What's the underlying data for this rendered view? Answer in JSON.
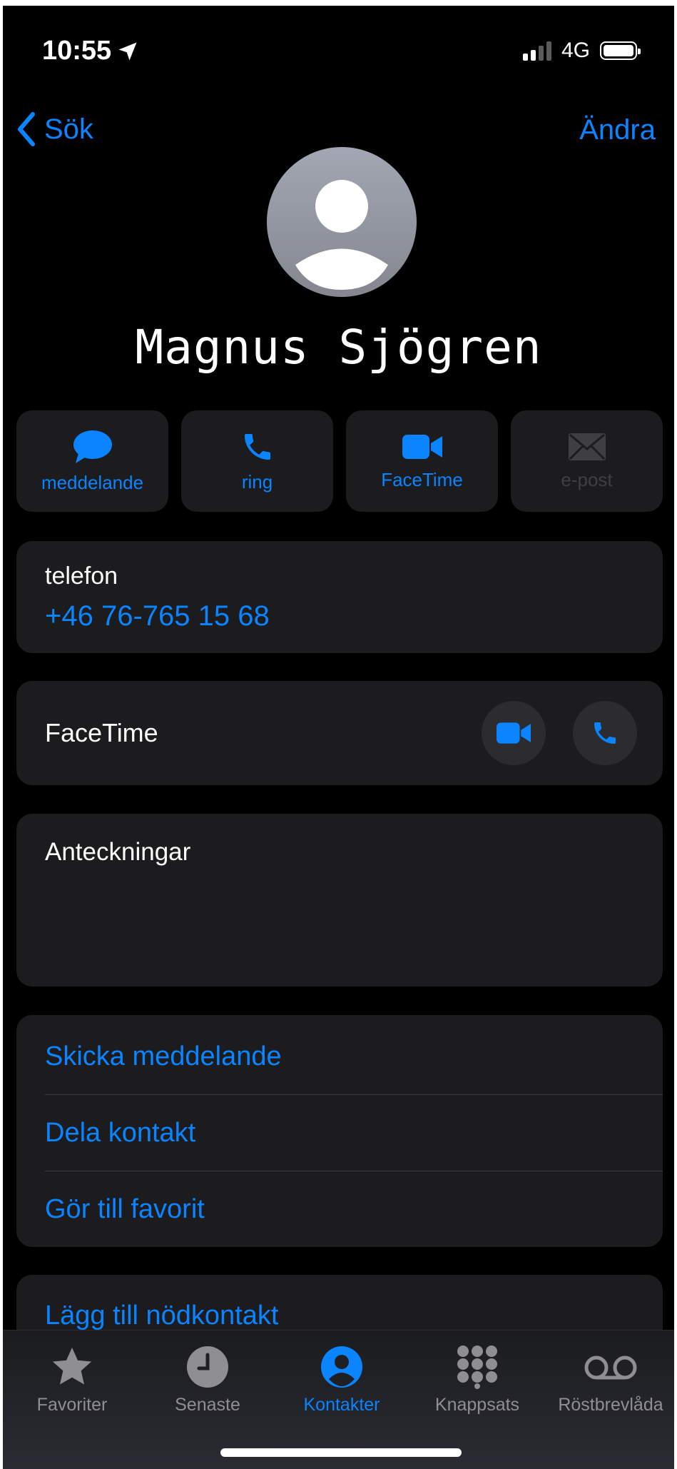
{
  "status": {
    "time": "10:55",
    "network": "4G"
  },
  "nav": {
    "back_label": "Sök",
    "edit_label": "Ändra"
  },
  "contact": {
    "name": "Magnus Sjögren"
  },
  "actions": [
    {
      "label": "meddelande",
      "icon": "message-bubble-icon",
      "enabled": true
    },
    {
      "label": "ring",
      "icon": "phone-icon",
      "enabled": true
    },
    {
      "label": "FaceTime",
      "icon": "video-camera-icon",
      "enabled": true
    },
    {
      "label": "e-post",
      "icon": "envelope-icon",
      "enabled": false
    }
  ],
  "phone": {
    "label": "telefon",
    "number": "+46 76-765 15 68"
  },
  "facetime": {
    "label": "FaceTime"
  },
  "notes": {
    "label": "Anteckningar"
  },
  "links": [
    "Skicka meddelande",
    "Dela kontakt",
    "Gör till favorit"
  ],
  "emergency": {
    "label": "Lägg till nödkontakt"
  },
  "tabs": [
    {
      "label": "Favoriter",
      "icon": "star-icon",
      "active": false
    },
    {
      "label": "Senaste",
      "icon": "clock-icon",
      "active": false
    },
    {
      "label": "Kontakter",
      "icon": "person-circle-icon",
      "active": true
    },
    {
      "label": "Knappsats",
      "icon": "keypad-icon",
      "active": false
    },
    {
      "label": "Röstbrevlåda",
      "icon": "voicemail-icon",
      "active": false
    }
  ],
  "colors": {
    "accent": "#0a84ff",
    "background": "#000000",
    "card": "#1c1c1e",
    "inactive": "#8e8e93"
  }
}
